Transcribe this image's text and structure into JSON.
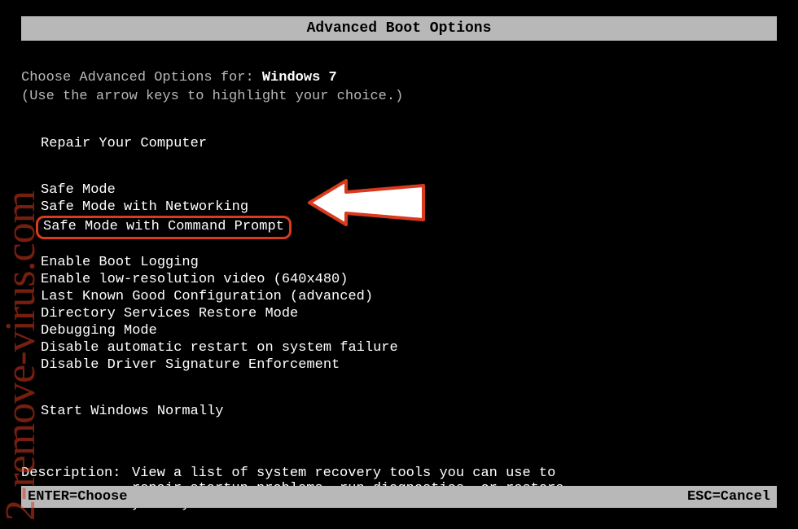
{
  "title": "Advanced Boot Options",
  "choose": {
    "label": "Choose Advanced Options for: ",
    "os": "Windows 7"
  },
  "hint": "(Use the arrow keys to highlight your choice.)",
  "groups": [
    {
      "items": [
        "Repair Your Computer"
      ]
    },
    {
      "items": [
        "Safe Mode",
        "Safe Mode with Networking",
        "Safe Mode with Command Prompt"
      ],
      "highlighted_index": 2
    },
    {
      "items": [
        "Enable Boot Logging",
        "Enable low-resolution video (640x480)",
        "Last Known Good Configuration (advanced)",
        "Directory Services Restore Mode",
        "Debugging Mode",
        "Disable automatic restart on system failure",
        "Disable Driver Signature Enforcement"
      ]
    },
    {
      "items": [
        "Start Windows Normally"
      ]
    }
  ],
  "description": {
    "label": "Description:",
    "text": "View a list of system recovery tools you can use to repair startup problems, run diagnostics, or restore your system."
  },
  "bottom": {
    "enter": "ENTER=Choose",
    "esc": "ESC=Cancel"
  },
  "watermark": "2-remove-virus.com"
}
